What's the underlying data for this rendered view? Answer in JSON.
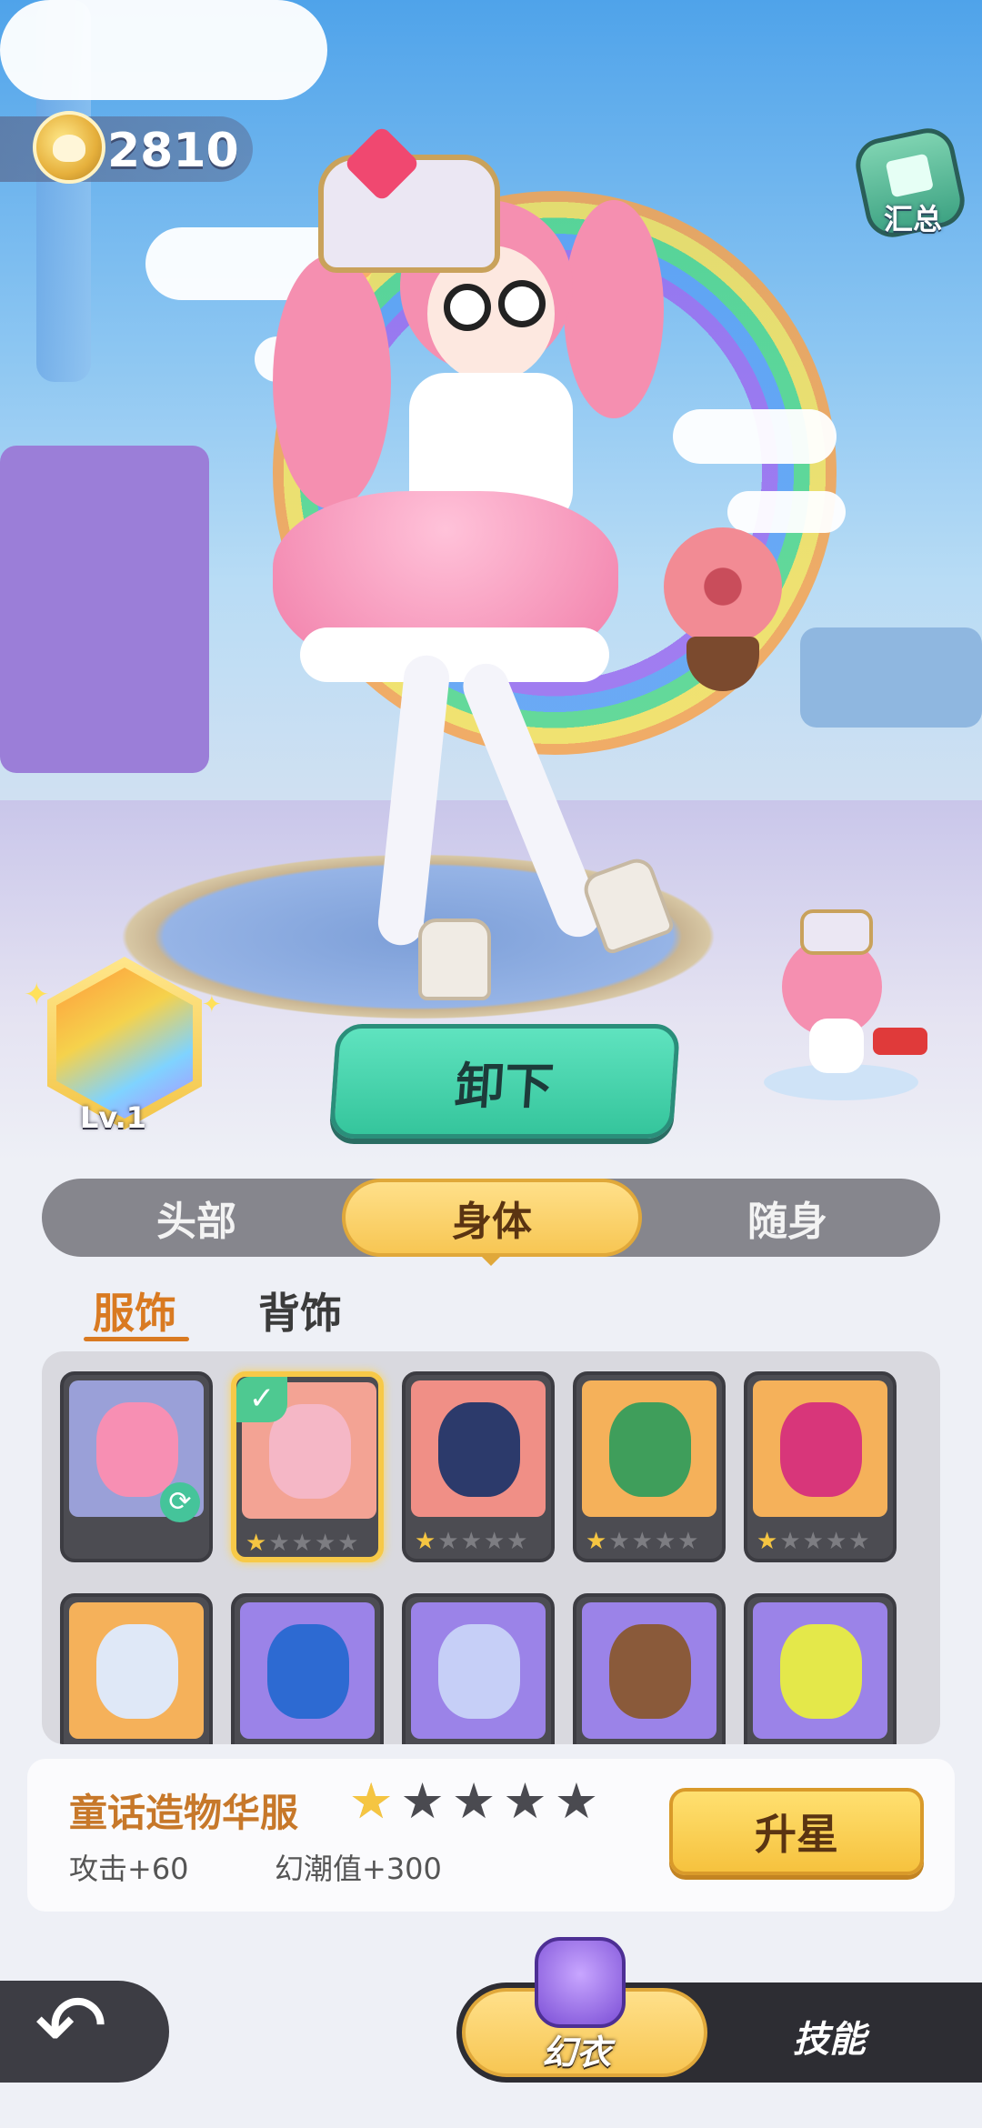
{
  "currency": {
    "value": "2810",
    "icon": "coin-icon"
  },
  "summary": {
    "label": "汇总"
  },
  "skill": {
    "level": "Lv.1"
  },
  "unequip_label": "卸下",
  "part_tabs": [
    {
      "label": "头部",
      "active": false
    },
    {
      "label": "身体",
      "active": true
    },
    {
      "label": "随身",
      "active": false
    }
  ],
  "sub_tabs": [
    {
      "label": "服饰",
      "active": true
    },
    {
      "label": "背饰",
      "active": false
    }
  ],
  "items": [
    {
      "name": "character-default",
      "bg": "#9aa0d8",
      "stars": null,
      "selected": false
    },
    {
      "name": "fairytale-dress",
      "bg": "#f3a394",
      "stars": 1,
      "selected": true
    },
    {
      "name": "dark-armor",
      "bg": "#f08f86",
      "stars": 1,
      "selected": false
    },
    {
      "name": "frog-costume",
      "bg": "#f5b15a",
      "stars": 1,
      "selected": false
    },
    {
      "name": "pink-jacket",
      "bg": "#f5b15a",
      "stars": 1,
      "selected": false
    },
    {
      "name": "white-jacket",
      "bg": "#f5b15a",
      "stars": null,
      "selected": false
    },
    {
      "name": "blue-swimsuit",
      "bg": "#9b83e8",
      "stars": null,
      "selected": false
    },
    {
      "name": "zip-hoodie",
      "bg": "#9b83e8",
      "stars": null,
      "selected": false
    },
    {
      "name": "school-uniform",
      "bg": "#9b83e8",
      "stars": null,
      "selected": false
    },
    {
      "name": "sport-jacket",
      "bg": "#9b83e8",
      "stars": null,
      "selected": false
    }
  ],
  "detail": {
    "name": "童话造物华服",
    "stars": 1,
    "max_stars": 5,
    "stat_attack": "攻击+60",
    "stat_trend": "幻潮值+300",
    "upgrade_label": "升星"
  },
  "bottom": {
    "mode_active": "幻衣",
    "mode_other": "技能"
  },
  "colors": {
    "accent_gold": "#f7c653",
    "accent_green": "#35c59c",
    "star_on": "#f5c542"
  }
}
